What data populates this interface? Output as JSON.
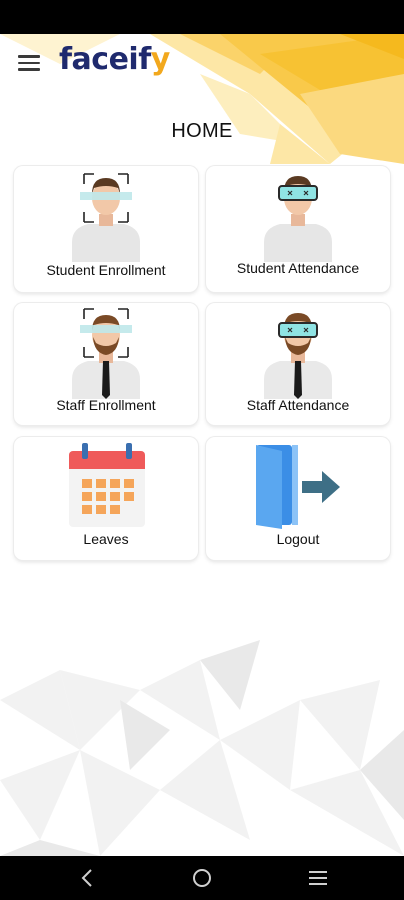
{
  "app": {
    "logo_main": "faceif",
    "logo_tail": "y"
  },
  "page": {
    "title": "HOME"
  },
  "tiles": [
    {
      "label": "Student Enrollment",
      "icon": "student-enrollment-icon"
    },
    {
      "label": "Student Attendance",
      "icon": "student-attendance-icon"
    },
    {
      "label": "Staff Enrollment",
      "icon": "staff-enrollment-icon"
    },
    {
      "label": "Staff Attendance",
      "icon": "staff-attendance-icon"
    },
    {
      "label": "Leaves",
      "icon": "calendar-icon"
    },
    {
      "label": "Logout",
      "icon": "logout-door-icon"
    }
  ],
  "colors": {
    "brand_navy": "#1f2a6e",
    "brand_yellow": "#f2a81d",
    "visor": "#8fe3e3"
  }
}
